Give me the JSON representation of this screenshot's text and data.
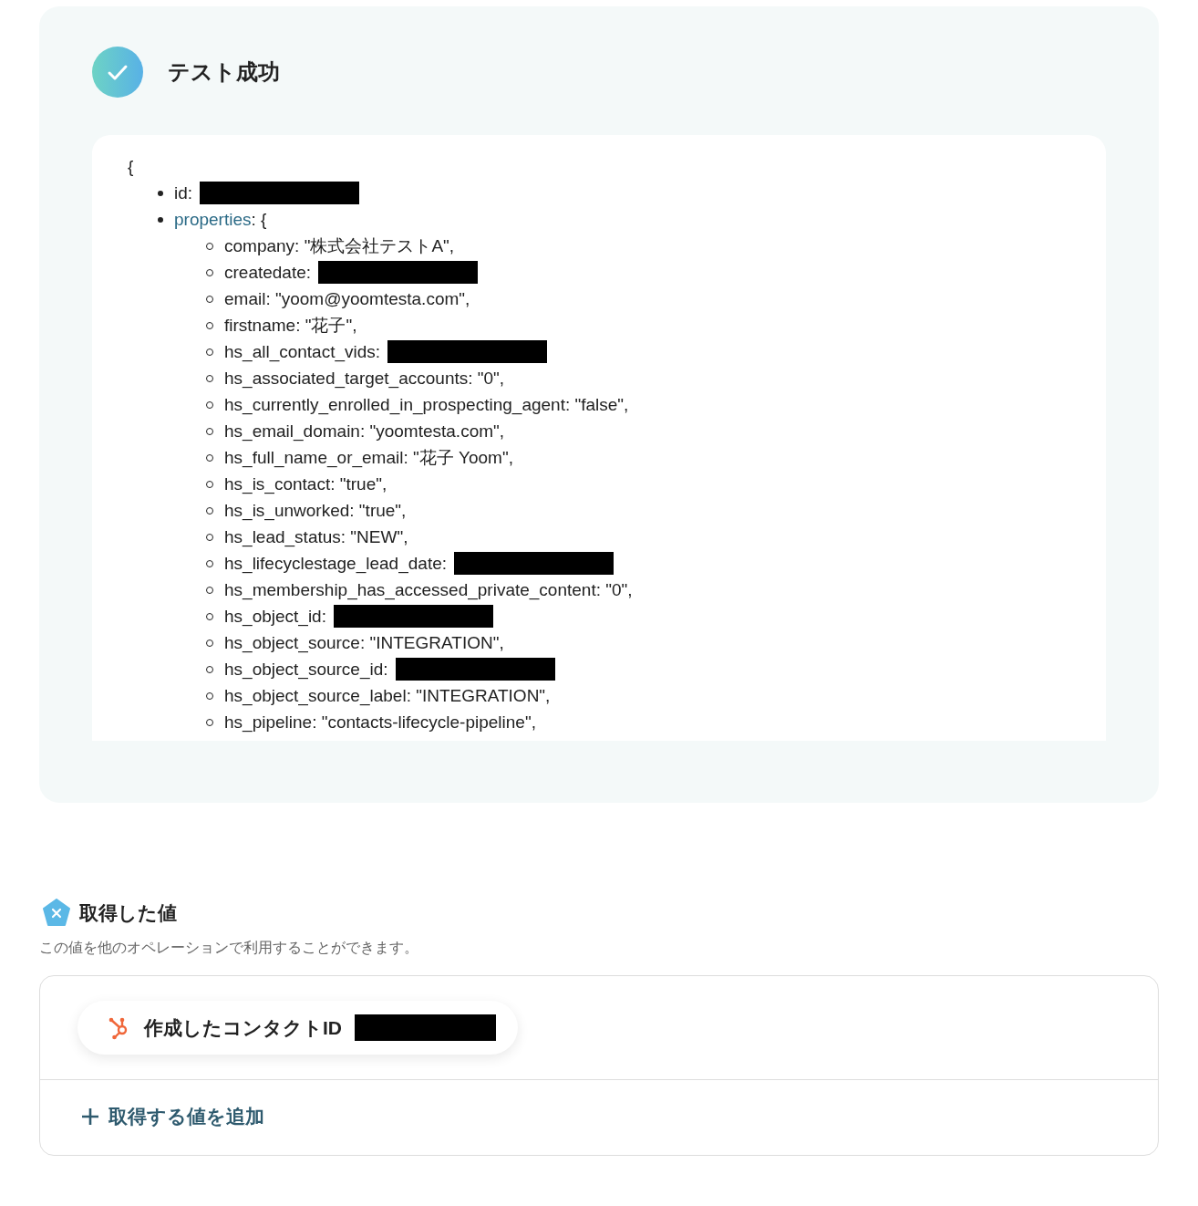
{
  "result": {
    "title": "テスト成功",
    "open_brace": "{",
    "fields": [
      {
        "text": "id:",
        "redacted": true
      },
      {
        "key": "properties",
        "text": ": {",
        "children": [
          {
            "text": "company: \"株式会社テストA\",",
            "redacted": false
          },
          {
            "text": "createdate:",
            "redacted": true
          },
          {
            "text": "email: \"yoom@yoomtesta.com\",",
            "redacted": false
          },
          {
            "text": "firstname: \"花子\",",
            "redacted": false
          },
          {
            "text": "hs_all_contact_vids:",
            "redacted": true
          },
          {
            "text": "hs_associated_target_accounts: \"0\",",
            "redacted": false
          },
          {
            "text": "hs_currently_enrolled_in_prospecting_agent: \"false\",",
            "redacted": false
          },
          {
            "text": "hs_email_domain: \"yoomtesta.com\",",
            "redacted": false
          },
          {
            "text": "hs_full_name_or_email: \"花子 Yoom\",",
            "redacted": false
          },
          {
            "text": "hs_is_contact: \"true\",",
            "redacted": false
          },
          {
            "text": "hs_is_unworked: \"true\",",
            "redacted": false
          },
          {
            "text": "hs_lead_status: \"NEW\",",
            "redacted": false
          },
          {
            "text": "hs_lifecyclestage_lead_date:",
            "redacted": true
          },
          {
            "text": "hs_membership_has_accessed_private_content: \"0\",",
            "redacted": false
          },
          {
            "text": "hs_object_id:",
            "redacted": true
          },
          {
            "text": "hs_object_source: \"INTEGRATION\",",
            "redacted": false
          },
          {
            "text": "hs_object_source_id:",
            "redacted": true
          },
          {
            "text": "hs_object_source_label: \"INTEGRATION\",",
            "redacted": false
          },
          {
            "text": "hs_pipeline: \"contacts-lifecycle-pipeline\",",
            "redacted": false
          }
        ]
      }
    ]
  },
  "values": {
    "title": "取得した値",
    "description": "この値を他のオペレーションで利用することができます。",
    "items": [
      {
        "label": "作成したコンタクトID",
        "redacted": true
      }
    ],
    "add_button": "取得する値を追加"
  }
}
